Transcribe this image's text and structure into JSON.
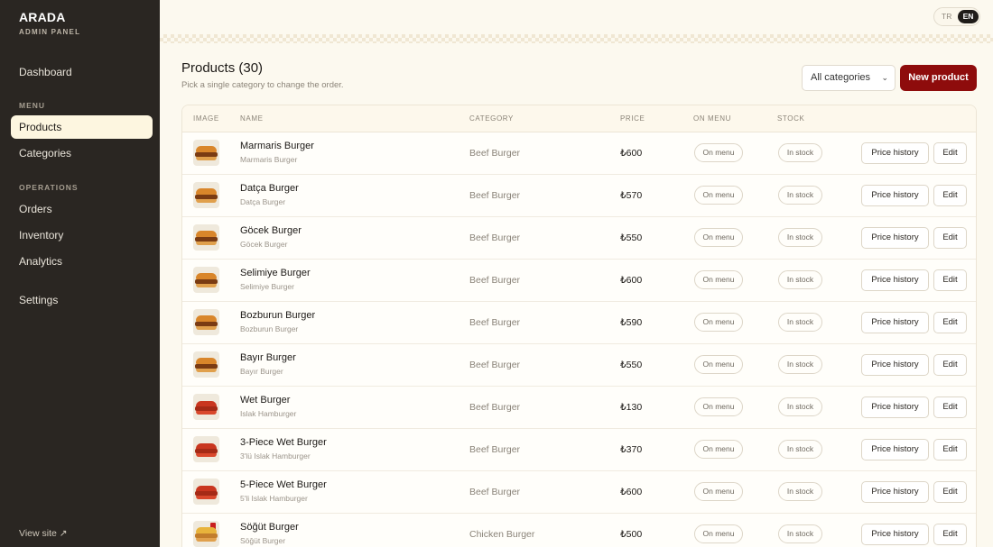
{
  "sidebar": {
    "brand": "ARADA",
    "brand_sub": "ADMIN PANEL",
    "dashboard": "Dashboard",
    "section_menu": "MENU",
    "products": "Products",
    "categories": "Categories",
    "section_operations": "OPERATIONS",
    "orders": "Orders",
    "inventory": "Inventory",
    "analytics": "Analytics",
    "settings": "Settings",
    "view_site": "View site ↗"
  },
  "lang": {
    "tr": "TR",
    "en": "EN",
    "active": "EN"
  },
  "header": {
    "title": "Products (30)",
    "subtitle": "Pick a single category to change the order.",
    "category_select": "All categories",
    "new_product": "New product"
  },
  "table": {
    "columns": [
      "IMAGE",
      "NAME",
      "CATEGORY",
      "PRICE",
      "ON MENU",
      "STOCK"
    ],
    "price_history_label": "Price history",
    "edit_label": "Edit",
    "rows": [
      {
        "name": "Marmaris Burger",
        "sub": "Marmaris Burger",
        "category": "Beef Burger",
        "price": "₺600",
        "menu": "On menu",
        "stock": "In stock",
        "icon": "beef-burger-thumb"
      },
      {
        "name": "Datça Burger",
        "sub": "Datça Burger",
        "category": "Beef Burger",
        "price": "₺570",
        "menu": "On menu",
        "stock": "In stock",
        "icon": "beef-burger-thumb"
      },
      {
        "name": "Göcek Burger",
        "sub": "Göcek Burger",
        "category": "Beef Burger",
        "price": "₺550",
        "menu": "On menu",
        "stock": "In stock",
        "icon": "beef-burger-thumb"
      },
      {
        "name": "Selimiye Burger",
        "sub": "Selimiye Burger",
        "category": "Beef Burger",
        "price": "₺600",
        "menu": "On menu",
        "stock": "In stock",
        "icon": "beef-burger-thumb"
      },
      {
        "name": "Bozburun Burger",
        "sub": "Bozburun Burger",
        "category": "Beef Burger",
        "price": "₺590",
        "menu": "On menu",
        "stock": "In stock",
        "icon": "beef-burger-thumb"
      },
      {
        "name": "Bayır Burger",
        "sub": "Bayır Burger",
        "category": "Beef Burger",
        "price": "₺550",
        "menu": "On menu",
        "stock": "In stock",
        "icon": "beef-burger-thumb"
      },
      {
        "name": "Wet Burger",
        "sub": "Islak Hamburger",
        "category": "Beef Burger",
        "price": "₺130",
        "menu": "On menu",
        "stock": "In stock",
        "icon": "wet-burger-thumb"
      },
      {
        "name": "3-Piece Wet Burger",
        "sub": "3'lü Islak Hamburger",
        "category": "Beef Burger",
        "price": "₺370",
        "menu": "On menu",
        "stock": "In stock",
        "icon": "wet-burger-thumb"
      },
      {
        "name": "5-Piece Wet Burger",
        "sub": "5'li Islak Hamburger",
        "category": "Beef Burger",
        "price": "₺600",
        "menu": "On menu",
        "stock": "In stock",
        "icon": "wet-burger-thumb"
      },
      {
        "name": "Söğüt Burger",
        "sub": "Söğüt Burger",
        "category": "Chicken Burger",
        "price": "₺500",
        "menu": "On menu",
        "stock": "In stock",
        "icon": "chicken-burger-thumb"
      }
    ]
  },
  "colors": {
    "sidebar_bg": "#2a2622",
    "page_bg": "#fcf9ef",
    "primary_button": "#8e0c0c",
    "active_nav_bg": "#fdf6e0"
  }
}
